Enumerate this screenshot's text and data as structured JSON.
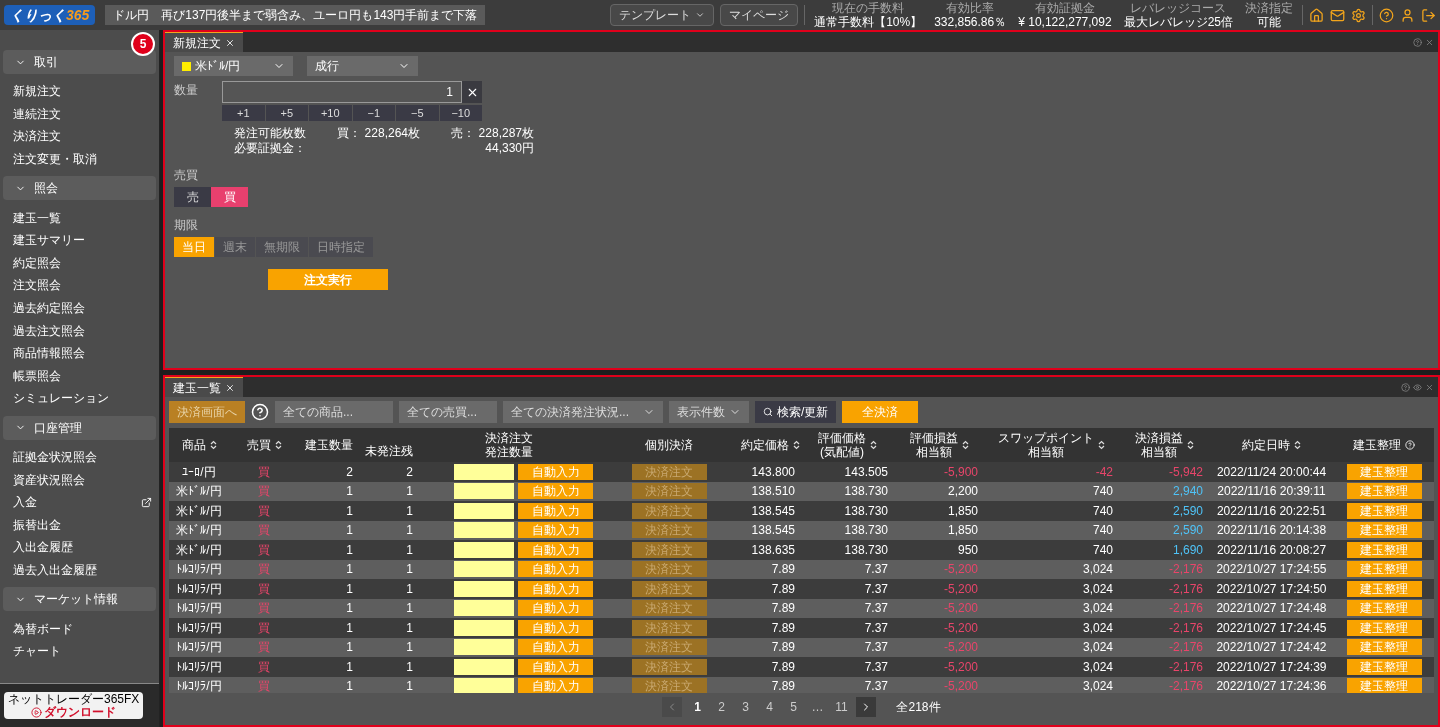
{
  "header": {
    "logo": {
      "main": "くりっく",
      "accent": "365"
    },
    "news": "ドル円　再び137円後半まで弱含み、ユーロ円も143円手前まで下落",
    "buttons": [
      {
        "label": "テンプレート",
        "dropdown": true
      },
      {
        "label": "マイページ",
        "dropdown": false
      }
    ],
    "stats": [
      {
        "label": "現在の手数料",
        "value": "通常手数料【10%】"
      },
      {
        "label": "有効比率",
        "value": "332,856.86％"
      },
      {
        "label": "有効証拠金",
        "value": "¥ 10,122,277,092"
      },
      {
        "label": "レバレッジコース",
        "value": "最大レバレッジ25倍"
      },
      {
        "label": "決済指定",
        "value": "可能"
      }
    ]
  },
  "step_badge": "5",
  "sidebar": {
    "sections": [
      {
        "title": "取引",
        "expanded": true,
        "items": [
          {
            "label": "新規注文",
            "external": false
          },
          {
            "label": "連続注文",
            "external": false
          },
          {
            "label": "決済注文",
            "external": false
          },
          {
            "label": "注文変更・取消",
            "external": false
          }
        ]
      },
      {
        "title": "照会",
        "expanded": true,
        "items": [
          {
            "label": "建玉一覧",
            "external": false
          },
          {
            "label": "建玉サマリー",
            "external": false
          },
          {
            "label": "約定照会",
            "external": false
          },
          {
            "label": "注文照会",
            "external": false
          },
          {
            "label": "過去約定照会",
            "external": false
          },
          {
            "label": "過去注文照会",
            "external": false
          },
          {
            "label": "商品情報照会",
            "external": false
          },
          {
            "label": "帳票照会",
            "external": false
          },
          {
            "label": "シミュレーション",
            "external": false
          }
        ]
      },
      {
        "title": "口座管理",
        "expanded": true,
        "items": [
          {
            "label": "証拠金状況照会",
            "external": false
          },
          {
            "label": "資産状況照会",
            "external": false
          },
          {
            "label": "入金",
            "external": true
          },
          {
            "label": "振替出金",
            "external": false
          },
          {
            "label": "入出金履歴",
            "external": false
          },
          {
            "label": "過去入出金履歴",
            "external": false
          }
        ]
      },
      {
        "title": "マーケット情報",
        "expanded": true,
        "items": [
          {
            "label": "為替ボード",
            "external": false
          },
          {
            "label": "チャート",
            "external": false
          }
        ]
      }
    ],
    "download": {
      "line1": "ネットトレーダー365FX",
      "line2": "ダウンロード"
    }
  },
  "order_panel": {
    "tab": "新規注文",
    "symbol": {
      "label": "米ﾄﾞﾙ/円",
      "color": "#ffee00"
    },
    "order_type": "成行",
    "quantity_label": "数量",
    "quantity": "1",
    "steps": [
      "+1",
      "+5",
      "+10",
      "−1",
      "−5",
      "−10"
    ],
    "available": {
      "label": "発注可能枚数",
      "buy_label": "買：",
      "buy": "228,264枚",
      "sell_label": "売：",
      "sell": "228,287枚"
    },
    "margin": {
      "label": "必要証拠金：",
      "value": "44,330円"
    },
    "side_label": "売買",
    "sides": [
      {
        "label": "売",
        "selected": false
      },
      {
        "label": "買",
        "selected": true
      }
    ],
    "expiry_label": "期限",
    "expiries": [
      {
        "label": "当日",
        "selected": true
      },
      {
        "label": "週末",
        "selected": false
      },
      {
        "label": "無期限",
        "selected": false
      },
      {
        "label": "日時指定",
        "selected": false
      }
    ],
    "submit": "注文実行"
  },
  "positions_panel": {
    "tab": "建玉一覧",
    "toolbar": {
      "settle_screen": "決済画面へ",
      "filters": [
        {
          "placeholder": "全ての商品...",
          "dropdown": false
        },
        {
          "placeholder": "全ての売買...",
          "dropdown": false
        },
        {
          "placeholder": "全ての決済発注状況...",
          "dropdown": true
        },
        {
          "placeholder": "表示件数",
          "dropdown": true
        }
      ],
      "search": "検索/更新",
      "settle_all": "全決済"
    },
    "columns": [
      {
        "label": "商品",
        "sortable": true,
        "help": false
      },
      {
        "label": "売買",
        "sortable": true,
        "help": false
      },
      {
        "label": "建玉数量",
        "sortable": false,
        "help": false
      },
      {
        "label": "未発注残",
        "sortable": false,
        "help": false
      },
      {
        "label": "決済注文",
        "sub": "発注数量",
        "sortable": false,
        "help": false
      },
      {
        "label": "個別決済",
        "sortable": false,
        "help": false
      },
      {
        "label": "約定価格",
        "sortable": true,
        "help": false
      },
      {
        "label": "評価価格",
        "sub": "(気配値)",
        "sortable": true,
        "help": false
      },
      {
        "label": "評価損益",
        "sub": "相当額",
        "sortable": true,
        "help": false
      },
      {
        "label": "スワップポイント",
        "sub": "相当額",
        "sortable": true,
        "help": false
      },
      {
        "label": "決済損益",
        "sub": "相当額",
        "sortable": true,
        "help": false
      },
      {
        "label": "約定日時",
        "sortable": true,
        "help": false
      },
      {
        "label": "建玉整理",
        "sortable": false,
        "help": true
      }
    ],
    "rows": [
      {
        "symbol": "ﾕｰﾛ/円",
        "side": "買",
        "qty": "2",
        "unordered": "2",
        "auto_label": "自動入力",
        "settle_label": "決済注文",
        "price": "143.800",
        "eval_price": "143.505",
        "eval_pnl": {
          "text": "-5,900",
          "loss": true,
          "gain": false
        },
        "swap": {
          "text": "-42",
          "loss": true,
          "gain": false
        },
        "settle_pnl": {
          "text": "-5,942",
          "loss": true,
          "gain": false
        },
        "time": "2022/11/24 20:00:44",
        "organize_label": "建玉整理"
      },
      {
        "symbol": "米ﾄﾞﾙ/円",
        "side": "買",
        "qty": "1",
        "unordered": "1",
        "auto_label": "自動入力",
        "settle_label": "決済注文",
        "price": "138.510",
        "eval_price": "138.730",
        "eval_pnl": {
          "text": "2,200",
          "loss": false,
          "gain": false
        },
        "swap": {
          "text": "740",
          "loss": false,
          "gain": false
        },
        "settle_pnl": {
          "text": "2,940",
          "loss": false,
          "gain": true
        },
        "time": "2022/11/16 20:39:11",
        "organize_label": "建玉整理"
      },
      {
        "symbol": "米ﾄﾞﾙ/円",
        "side": "買",
        "qty": "1",
        "unordered": "1",
        "auto_label": "自動入力",
        "settle_label": "決済注文",
        "price": "138.545",
        "eval_price": "138.730",
        "eval_pnl": {
          "text": "1,850",
          "loss": false,
          "gain": false
        },
        "swap": {
          "text": "740",
          "loss": false,
          "gain": false
        },
        "settle_pnl": {
          "text": "2,590",
          "loss": false,
          "gain": true
        },
        "time": "2022/11/16 20:22:51",
        "organize_label": "建玉整理"
      },
      {
        "symbol": "米ﾄﾞﾙ/円",
        "side": "買",
        "qty": "1",
        "unordered": "1",
        "auto_label": "自動入力",
        "settle_label": "決済注文",
        "price": "138.545",
        "eval_price": "138.730",
        "eval_pnl": {
          "text": "1,850",
          "loss": false,
          "gain": false
        },
        "swap": {
          "text": "740",
          "loss": false,
          "gain": false
        },
        "settle_pnl": {
          "text": "2,590",
          "loss": false,
          "gain": true
        },
        "time": "2022/11/16 20:14:38",
        "organize_label": "建玉整理"
      },
      {
        "symbol": "米ﾄﾞﾙ/円",
        "side": "買",
        "qty": "1",
        "unordered": "1",
        "auto_label": "自動入力",
        "settle_label": "決済注文",
        "price": "138.635",
        "eval_price": "138.730",
        "eval_pnl": {
          "text": "950",
          "loss": false,
          "gain": false
        },
        "swap": {
          "text": "740",
          "loss": false,
          "gain": false
        },
        "settle_pnl": {
          "text": "1,690",
          "loss": false,
          "gain": true
        },
        "time": "2022/11/16 20:08:27",
        "organize_label": "建玉整理"
      },
      {
        "symbol": "ﾄﾙｺﾘﾗ/円",
        "side": "買",
        "qty": "1",
        "unordered": "1",
        "auto_label": "自動入力",
        "settle_label": "決済注文",
        "price": "7.89",
        "eval_price": "7.37",
        "eval_pnl": {
          "text": "-5,200",
          "loss": true,
          "gain": false
        },
        "swap": {
          "text": "3,024",
          "loss": false,
          "gain": false
        },
        "settle_pnl": {
          "text": "-2,176",
          "loss": true,
          "gain": false
        },
        "time": "2022/10/27 17:24:55",
        "organize_label": "建玉整理"
      },
      {
        "symbol": "ﾄﾙｺﾘﾗ/円",
        "side": "買",
        "qty": "1",
        "unordered": "1",
        "auto_label": "自動入力",
        "settle_label": "決済注文",
        "price": "7.89",
        "eval_price": "7.37",
        "eval_pnl": {
          "text": "-5,200",
          "loss": true,
          "gain": false
        },
        "swap": {
          "text": "3,024",
          "loss": false,
          "gain": false
        },
        "settle_pnl": {
          "text": "-2,176",
          "loss": true,
          "gain": false
        },
        "time": "2022/10/27 17:24:50",
        "organize_label": "建玉整理"
      },
      {
        "symbol": "ﾄﾙｺﾘﾗ/円",
        "side": "買",
        "qty": "1",
        "unordered": "1",
        "auto_label": "自動入力",
        "settle_label": "決済注文",
        "price": "7.89",
        "eval_price": "7.37",
        "eval_pnl": {
          "text": "-5,200",
          "loss": true,
          "gain": false
        },
        "swap": {
          "text": "3,024",
          "loss": false,
          "gain": false
        },
        "settle_pnl": {
          "text": "-2,176",
          "loss": true,
          "gain": false
        },
        "time": "2022/10/27 17:24:48",
        "organize_label": "建玉整理"
      },
      {
        "symbol": "ﾄﾙｺﾘﾗ/円",
        "side": "買",
        "qty": "1",
        "unordered": "1",
        "auto_label": "自動入力",
        "settle_label": "決済注文",
        "price": "7.89",
        "eval_price": "7.37",
        "eval_pnl": {
          "text": "-5,200",
          "loss": true,
          "gain": false
        },
        "swap": {
          "text": "3,024",
          "loss": false,
          "gain": false
        },
        "settle_pnl": {
          "text": "-2,176",
          "loss": true,
          "gain": false
        },
        "time": "2022/10/27 17:24:45",
        "organize_label": "建玉整理"
      },
      {
        "symbol": "ﾄﾙｺﾘﾗ/円",
        "side": "買",
        "qty": "1",
        "unordered": "1",
        "auto_label": "自動入力",
        "settle_label": "決済注文",
        "price": "7.89",
        "eval_price": "7.37",
        "eval_pnl": {
          "text": "-5,200",
          "loss": true,
          "gain": false
        },
        "swap": {
          "text": "3,024",
          "loss": false,
          "gain": false
        },
        "settle_pnl": {
          "text": "-2,176",
          "loss": true,
          "gain": false
        },
        "time": "2022/10/27 17:24:42",
        "organize_label": "建玉整理"
      },
      {
        "symbol": "ﾄﾙｺﾘﾗ/円",
        "side": "買",
        "qty": "1",
        "unordered": "1",
        "auto_label": "自動入力",
        "settle_label": "決済注文",
        "price": "7.89",
        "eval_price": "7.37",
        "eval_pnl": {
          "text": "-5,200",
          "loss": true,
          "gain": false
        },
        "swap": {
          "text": "3,024",
          "loss": false,
          "gain": false
        },
        "settle_pnl": {
          "text": "-2,176",
          "loss": true,
          "gain": false
        },
        "time": "2022/10/27 17:24:39",
        "organize_label": "建玉整理"
      },
      {
        "symbol": "ﾄﾙｺﾘﾗ/円",
        "side": "買",
        "qty": "1",
        "unordered": "1",
        "auto_label": "自動入力",
        "settle_label": "決済注文",
        "price": "7.89",
        "eval_price": "7.37",
        "eval_pnl": {
          "text": "-5,200",
          "loss": true,
          "gain": false
        },
        "swap": {
          "text": "3,024",
          "loss": false,
          "gain": false
        },
        "settle_pnl": {
          "text": "-2,176",
          "loss": true,
          "gain": false
        },
        "time": "2022/10/27 17:24:36",
        "organize_label": "建玉整理"
      }
    ],
    "pagination": {
      "pages": [
        {
          "label": "1",
          "selected": true
        },
        {
          "label": "2",
          "selected": false
        },
        {
          "label": "3",
          "selected": false
        },
        {
          "label": "4",
          "selected": false
        },
        {
          "label": "5",
          "selected": false
        },
        {
          "label": "…",
          "selected": false
        },
        {
          "label": "11",
          "selected": false
        }
      ],
      "total": "全218件"
    }
  }
}
